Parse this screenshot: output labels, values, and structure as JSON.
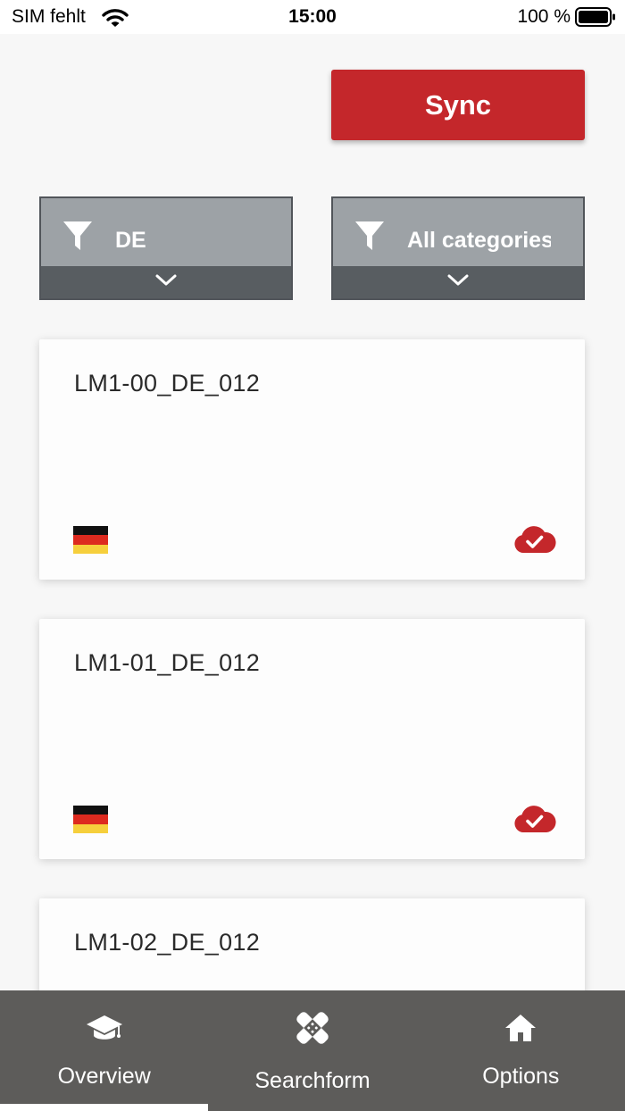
{
  "status_bar": {
    "carrier": "SIM fehlt",
    "time": "15:00",
    "battery": "100 %"
  },
  "sync_button": {
    "label": "Sync",
    "color": "#c4272b"
  },
  "filters": [
    {
      "label": "DE",
      "icon": "filter-icon"
    },
    {
      "label": "All categories",
      "icon": "filter-icon"
    }
  ],
  "cards": [
    {
      "title": "LM1-00_DE_012",
      "flag": "germany-flag-icon",
      "status": "cloud-synced-icon"
    },
    {
      "title": "LM1-01_DE_012",
      "flag": "germany-flag-icon",
      "status": "cloud-synced-icon"
    },
    {
      "title": "LM1-02_DE_012",
      "flag": "germany-flag-icon",
      "status": "cloud-synced-icon"
    }
  ],
  "tabs": [
    {
      "label": "Overview",
      "icon": "graduation-cap-icon",
      "active": true
    },
    {
      "label": "Searchform",
      "icon": "bandage-icon",
      "active": false
    },
    {
      "label": "Options",
      "icon": "home-icon",
      "active": false
    }
  ],
  "colors": {
    "accent": "#c4272b",
    "tab_bar": "#5d5c5a",
    "filter_top": "#9da2a6",
    "filter_bottom": "#585d61"
  }
}
